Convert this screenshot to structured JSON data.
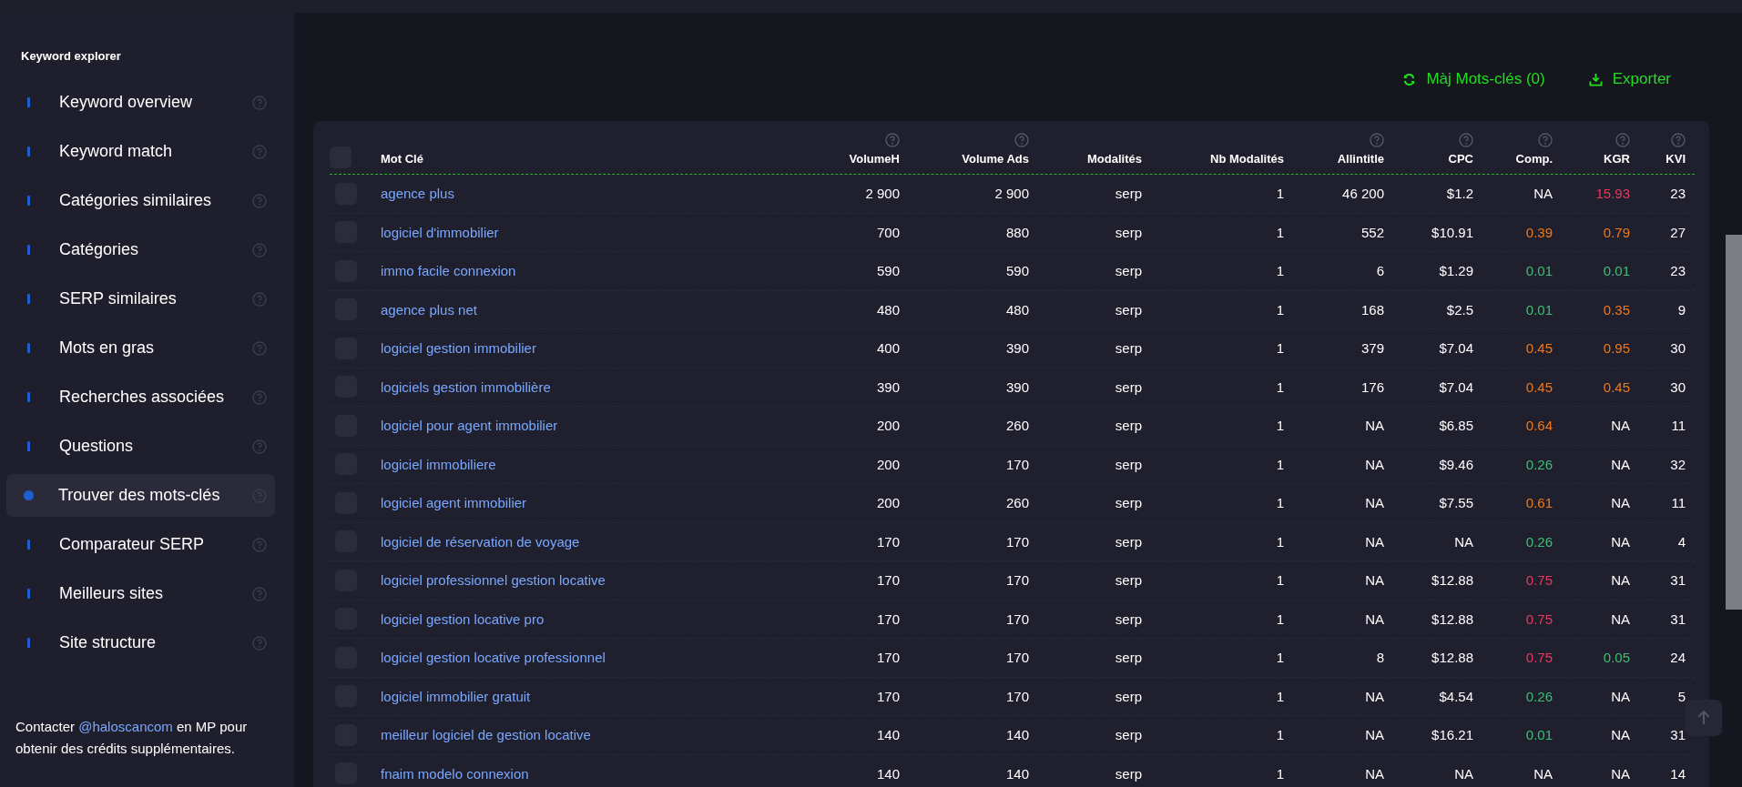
{
  "sidebar": {
    "title": "Keyword explorer",
    "items": [
      {
        "label": "Keyword overview",
        "selected": false
      },
      {
        "label": "Keyword match",
        "selected": false
      },
      {
        "label": "Catégories similaires",
        "selected": false
      },
      {
        "label": "Catégories",
        "selected": false
      },
      {
        "label": "SERP similaires",
        "selected": false
      },
      {
        "label": "Mots en gras",
        "selected": false
      },
      {
        "label": "Recherches associées",
        "selected": false
      },
      {
        "label": "Questions",
        "selected": false
      },
      {
        "label": "Trouver des mots-clés",
        "selected": true
      },
      {
        "label": "Comparateur SERP",
        "selected": false
      },
      {
        "label": "Meilleurs sites",
        "selected": false
      },
      {
        "label": "Site structure",
        "selected": false
      }
    ],
    "footer": {
      "before": "Contacter",
      "link": "@haloscancom",
      "after": "en MP pour obtenir des crédits supplémentaires."
    }
  },
  "actions": [
    {
      "kind": "refresh",
      "label": "Màj Mots-clés (0)"
    },
    {
      "kind": "export",
      "label": "Exporter"
    }
  ],
  "table": {
    "all_checked": false,
    "columns": [
      {
        "label": "Mot Clé",
        "help": false
      },
      {
        "label": "VolumeH",
        "help": true
      },
      {
        "label": "Volume Ads",
        "help": true
      },
      {
        "label": "Modalités",
        "help": false
      },
      {
        "label": "Nb Modalités",
        "help": false
      },
      {
        "label": "Allintitle",
        "help": true
      },
      {
        "label": "CPC",
        "help": true
      },
      {
        "label": "Comp.",
        "help": true
      },
      {
        "label": "KGR",
        "help": true
      },
      {
        "label": "KVI",
        "help": true
      }
    ],
    "rows": [
      {
        "checked": false,
        "keyword": "agence plus",
        "volume_h": "2 900",
        "volume_ads": "2 900",
        "modalites": "serp",
        "nb_modalites": "1",
        "allintitle": "46 200",
        "cpc": "$1.2",
        "comp": {
          "text": "NA",
          "color": "#ffffff"
        },
        "kgr": {
          "text": "15.93",
          "color": "#e8395f"
        },
        "kvi": "23"
      },
      {
        "checked": false,
        "keyword": "logiciel d'immobilier",
        "volume_h": "700",
        "volume_ads": "880",
        "modalites": "serp",
        "nb_modalites": "1",
        "allintitle": "552",
        "cpc": "$10.91",
        "comp": {
          "text": "0.39",
          "color": "#f07a1a"
        },
        "kgr": {
          "text": "0.79",
          "color": "#f07a1a"
        },
        "kvi": "27"
      },
      {
        "checked": false,
        "keyword": "immo facile connexion",
        "volume_h": "590",
        "volume_ads": "590",
        "modalites": "serp",
        "nb_modalites": "1",
        "allintitle": "6",
        "cpc": "$1.29",
        "comp": {
          "text": "0.01",
          "color": "#3fbf73"
        },
        "kgr": {
          "text": "0.01",
          "color": "#3fbf73"
        },
        "kvi": "23"
      },
      {
        "checked": false,
        "keyword": "agence plus net",
        "volume_h": "480",
        "volume_ads": "480",
        "modalites": "serp",
        "nb_modalites": "1",
        "allintitle": "168",
        "cpc": "$2.5",
        "comp": {
          "text": "0.01",
          "color": "#3fbf73"
        },
        "kgr": {
          "text": "0.35",
          "color": "#f07a1a"
        },
        "kvi": "9"
      },
      {
        "checked": false,
        "keyword": "logiciel gestion immobilier",
        "volume_h": "400",
        "volume_ads": "390",
        "modalites": "serp",
        "nb_modalites": "1",
        "allintitle": "379",
        "cpc": "$7.04",
        "comp": {
          "text": "0.45",
          "color": "#f07a1a"
        },
        "kgr": {
          "text": "0.95",
          "color": "#f07a1a"
        },
        "kvi": "30"
      },
      {
        "checked": false,
        "keyword": "logiciels gestion immobilière",
        "volume_h": "390",
        "volume_ads": "390",
        "modalites": "serp",
        "nb_modalites": "1",
        "allintitle": "176",
        "cpc": "$7.04",
        "comp": {
          "text": "0.45",
          "color": "#f07a1a"
        },
        "kgr": {
          "text": "0.45",
          "color": "#f07a1a"
        },
        "kvi": "30"
      },
      {
        "checked": false,
        "keyword": "logiciel pour agent immobilier",
        "volume_h": "200",
        "volume_ads": "260",
        "modalites": "serp",
        "nb_modalites": "1",
        "allintitle": "NA",
        "cpc": "$6.85",
        "comp": {
          "text": "0.64",
          "color": "#f07a1a"
        },
        "kgr": {
          "text": "NA",
          "color": "#ffffff"
        },
        "kvi": "11"
      },
      {
        "checked": false,
        "keyword": "logiciel immobiliere",
        "volume_h": "200",
        "volume_ads": "170",
        "modalites": "serp",
        "nb_modalites": "1",
        "allintitle": "NA",
        "cpc": "$9.46",
        "comp": {
          "text": "0.26",
          "color": "#3fbf73"
        },
        "kgr": {
          "text": "NA",
          "color": "#ffffff"
        },
        "kvi": "32"
      },
      {
        "checked": false,
        "keyword": "logiciel agent immobilier",
        "volume_h": "200",
        "volume_ads": "260",
        "modalites": "serp",
        "nb_modalites": "1",
        "allintitle": "NA",
        "cpc": "$7.55",
        "comp": {
          "text": "0.61",
          "color": "#f07a1a"
        },
        "kgr": {
          "text": "NA",
          "color": "#ffffff"
        },
        "kvi": "11"
      },
      {
        "checked": false,
        "keyword": "logiciel de réservation de voyage",
        "volume_h": "170",
        "volume_ads": "170",
        "modalites": "serp",
        "nb_modalites": "1",
        "allintitle": "NA",
        "cpc": "NA",
        "comp": {
          "text": "0.26",
          "color": "#3fbf73"
        },
        "kgr": {
          "text": "NA",
          "color": "#ffffff"
        },
        "kvi": "4"
      },
      {
        "checked": false,
        "keyword": "logiciel professionnel gestion locative",
        "volume_h": "170",
        "volume_ads": "170",
        "modalites": "serp",
        "nb_modalites": "1",
        "allintitle": "NA",
        "cpc": "$12.88",
        "comp": {
          "text": "0.75",
          "color": "#e8395f"
        },
        "kgr": {
          "text": "NA",
          "color": "#ffffff"
        },
        "kvi": "31"
      },
      {
        "checked": false,
        "keyword": "logiciel gestion locative pro",
        "volume_h": "170",
        "volume_ads": "170",
        "modalites": "serp",
        "nb_modalites": "1",
        "allintitle": "NA",
        "cpc": "$12.88",
        "comp": {
          "text": "0.75",
          "color": "#e8395f"
        },
        "kgr": {
          "text": "NA",
          "color": "#ffffff"
        },
        "kvi": "31"
      },
      {
        "checked": false,
        "keyword": "logiciel gestion locative professionnel",
        "volume_h": "170",
        "volume_ads": "170",
        "modalites": "serp",
        "nb_modalites": "1",
        "allintitle": "8",
        "cpc": "$12.88",
        "comp": {
          "text": "0.75",
          "color": "#e8395f"
        },
        "kgr": {
          "text": "0.05",
          "color": "#3fbf73"
        },
        "kvi": "24"
      },
      {
        "checked": false,
        "keyword": "logiciel immobilier gratuit",
        "volume_h": "170",
        "volume_ads": "170",
        "modalites": "serp",
        "nb_modalites": "1",
        "allintitle": "NA",
        "cpc": "$4.54",
        "comp": {
          "text": "0.26",
          "color": "#3fbf73"
        },
        "kgr": {
          "text": "NA",
          "color": "#ffffff"
        },
        "kvi": "5"
      },
      {
        "checked": false,
        "keyword": "meilleur logiciel de gestion locative",
        "volume_h": "140",
        "volume_ads": "140",
        "modalites": "serp",
        "nb_modalites": "1",
        "allintitle": "NA",
        "cpc": "$16.21",
        "comp": {
          "text": "0.01",
          "color": "#3fbf73"
        },
        "kgr": {
          "text": "NA",
          "color": "#ffffff"
        },
        "kvi": "31"
      },
      {
        "checked": false,
        "keyword": "fnaim modelo connexion",
        "volume_h": "140",
        "volume_ads": "140",
        "modalites": "serp",
        "nb_modalites": "1",
        "allintitle": "NA",
        "cpc": "NA",
        "comp": {
          "text": "NA",
          "color": "#ffffff"
        },
        "kgr": {
          "text": "NA",
          "color": "#ffffff"
        },
        "kvi": "14"
      }
    ]
  }
}
